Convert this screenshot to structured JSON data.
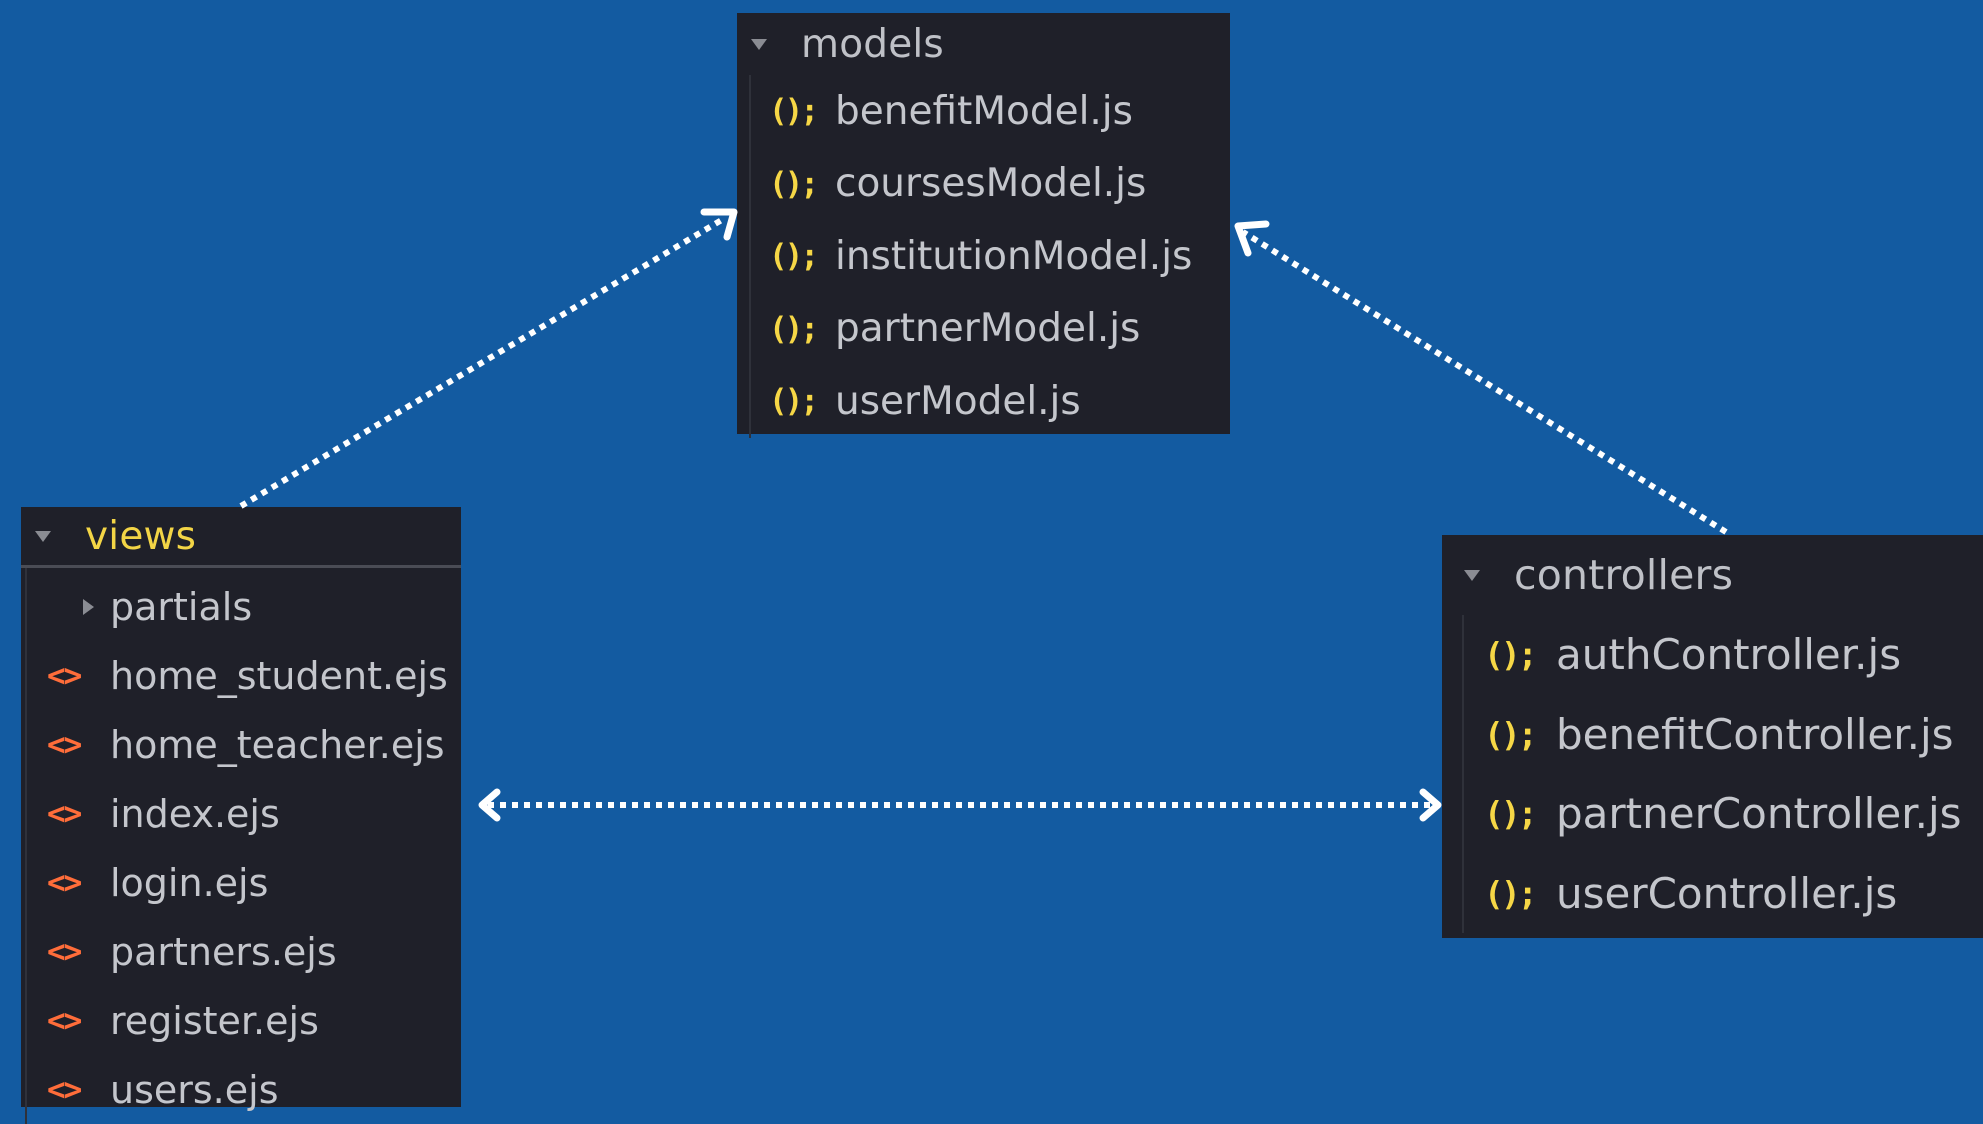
{
  "models": {
    "title": "models",
    "files": [
      "benefitModel.js",
      "coursesModel.js",
      "institutionModel.js",
      "partnerModel.js",
      "userModel.js"
    ]
  },
  "views": {
    "title": "views",
    "folder": "partials",
    "files": [
      "home_student.ejs",
      "home_teacher.ejs",
      "index.ejs",
      "login.ejs",
      "partners.ejs",
      "register.ejs",
      "users.ejs"
    ]
  },
  "controllers": {
    "title": "controllers",
    "files": [
      "authController.js",
      "benefitController.js",
      "partnerController.js",
      "userController.js"
    ]
  },
  "icons": {
    "js_glyph": "();",
    "html_glyph": "<>"
  },
  "colors": {
    "background": "#135ba1",
    "panel": "#1f2029",
    "js_icon": "#f6d746",
    "html_icon": "#ff6d3a",
    "views_title": "#f3d546",
    "arrow": "#ffffff"
  }
}
